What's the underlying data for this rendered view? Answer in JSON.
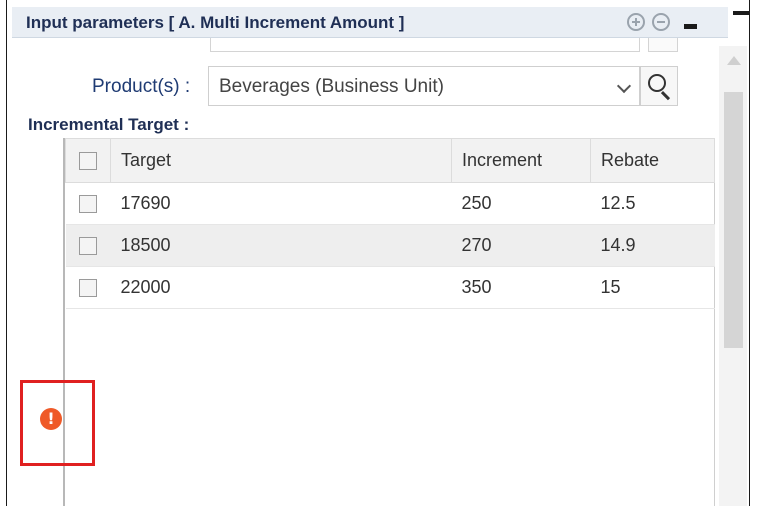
{
  "panel": {
    "title": "Input parameters [ A. Multi Increment Amount ]",
    "icons": [
      "zoom-in-icon",
      "zoom-out-icon",
      "minimize-icon",
      "maximize-icon"
    ]
  },
  "product": {
    "label": "Product(s) :",
    "value": "Beverages (Business Unit)"
  },
  "incremental": {
    "section_title": "Incremental Target :",
    "columns": [
      "Target",
      "Increment",
      "Rebate"
    ],
    "rows": [
      {
        "target": "17690",
        "increment": "250",
        "rebate": "12.5"
      },
      {
        "target": "18500",
        "increment": "270",
        "rebate": "14.9"
      },
      {
        "target": "22000",
        "increment": "350",
        "rebate": "15"
      }
    ]
  },
  "alert": {
    "glyph": "!",
    "color": "#ef5a28",
    "highlight": "#e02020"
  }
}
